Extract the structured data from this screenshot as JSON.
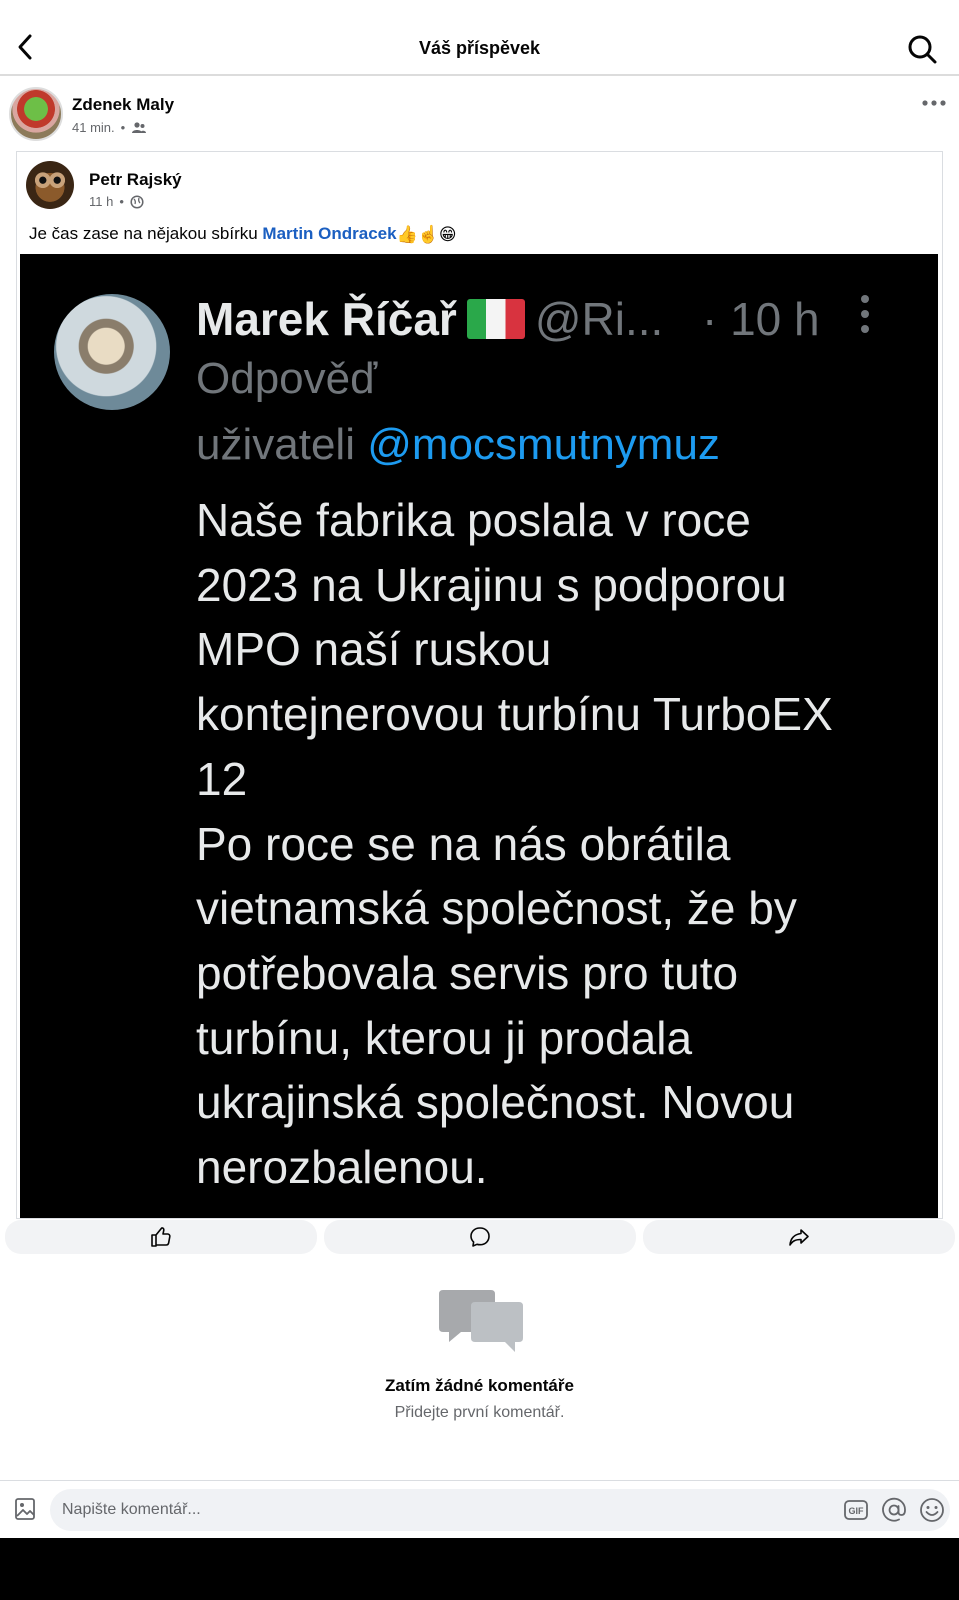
{
  "header": {
    "title": "Váš příspěvek",
    "back_icon": "chevron-left-icon",
    "search_icon": "search-icon"
  },
  "post": {
    "author": "Zdenek Maly",
    "time": "41 min.",
    "privacy_icon": "friends-icon",
    "more_icon": "more-horizontal-icon"
  },
  "shared": {
    "author": "Petr Rajský",
    "time": "11 h",
    "privacy_icon": "globe-icon",
    "text_before": "Je čas zase na nějakou sbírku ",
    "mention": "Martin Ondracek",
    "text_after": " 👍☝️😁"
  },
  "tweet": {
    "name": "Marek Říčař",
    "handle": "@Ri...",
    "time": "· 10 h",
    "reply_label": "Odpověď",
    "reply_to_prefix": "uživateli ",
    "reply_to_handle": "@mocsmutnymuz",
    "lines": [
      "Naše fabrika poslala v roce",
      "2023 na Ukrajinu s podporou",
      "MPO naší ruskou",
      "kontejnerovou turbínu TurboEX",
      "12",
      "Po roce se na nás obrátila",
      "vietnamská společnost, že by",
      "potřebovala servis pro tuto",
      "turbínu, kterou ji prodala",
      "ukrajinská společnost. Novou",
      "nerozbalenou."
    ]
  },
  "actions": {
    "like_icon": "like-icon",
    "comment_icon": "comment-icon",
    "share_icon": "share-icon"
  },
  "comments": {
    "empty_title": "Zatím žádné komentáře",
    "empty_subtitle": "Přidejte první komentář."
  },
  "composer": {
    "placeholder": "Napište komentář...",
    "icons": [
      "photo-icon",
      "gif-icon",
      "mention-icon",
      "emoji-icon"
    ]
  }
}
